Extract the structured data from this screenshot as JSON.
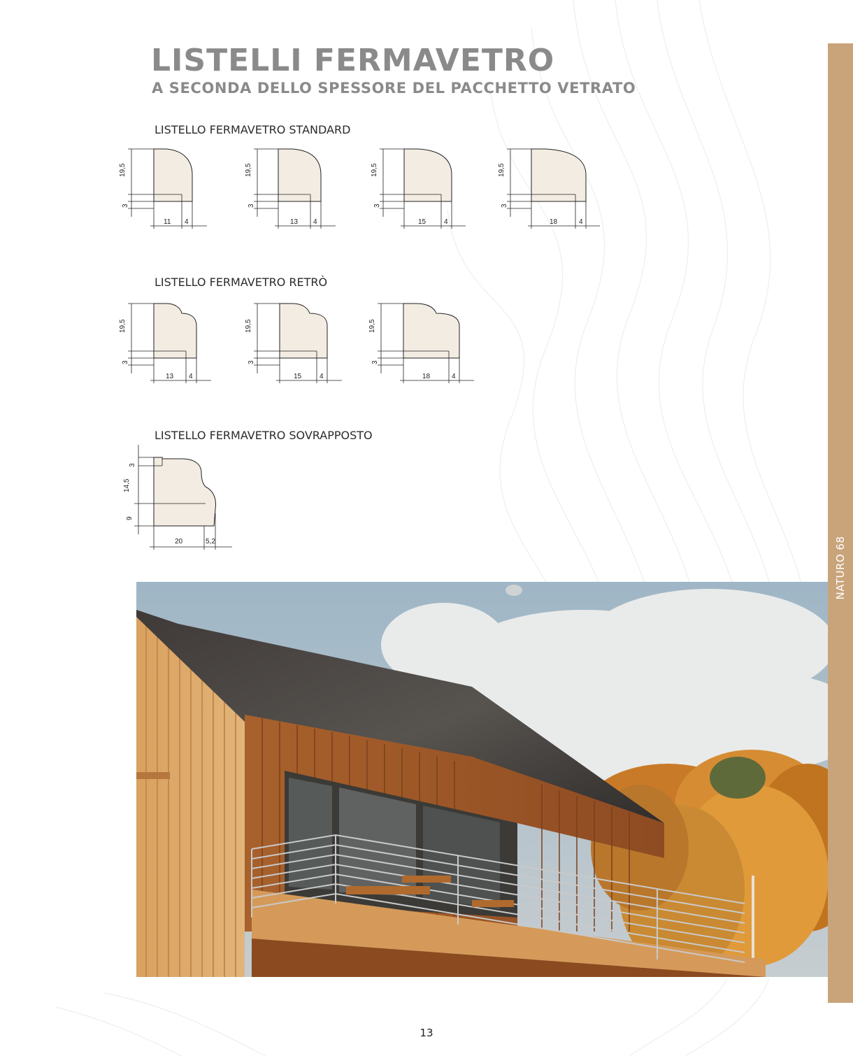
{
  "header": {
    "title": "LISTELLI FERMAVETRO",
    "subtitle": "A SECONDA DELLO SPESSORE DEL PACCHETTO VETRATO"
  },
  "sections": {
    "standard": {
      "label": "LISTELLO FERMAVETRO STANDARD",
      "profiles": [
        {
          "height": "19,5",
          "lip": "3",
          "width": "11",
          "offset": "4"
        },
        {
          "height": "19,5",
          "lip": "3",
          "width": "13",
          "offset": "4"
        },
        {
          "height": "19,5",
          "lip": "3",
          "width": "15",
          "offset": "4"
        },
        {
          "height": "19,5",
          "lip": "3",
          "width": "18",
          "offset": "4"
        }
      ]
    },
    "retro": {
      "label": "LISTELLO FERMAVETRO RETRÒ",
      "profiles": [
        {
          "height": "19,5",
          "lip": "3",
          "width": "13",
          "offset": "4"
        },
        {
          "height": "19,5",
          "lip": "3",
          "width": "15",
          "offset": "4"
        },
        {
          "height": "19,5",
          "lip": "3",
          "width": "18",
          "offset": "4"
        }
      ]
    },
    "sovrapposto": {
      "label": "LISTELLO FERMAVETRO SOVRAPPOSTO",
      "profile": {
        "top": "3",
        "middle": "14,5",
        "bottom": "9",
        "width": "20",
        "offset": "5,2"
      }
    }
  },
  "side_tab": {
    "label": "NATURO 68",
    "color": "#c9a47b"
  },
  "photo": {
    "subject": "wooden-house-with-balcony-autumn-trees"
  },
  "footer": {
    "page_number": "13"
  },
  "colors": {
    "title": "#8a8a8a",
    "profile_fill": "#f3ece3"
  }
}
